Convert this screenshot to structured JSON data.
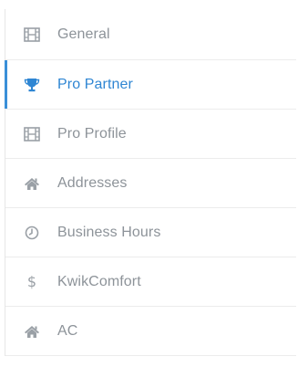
{
  "nav": {
    "items": [
      {
        "label": "General",
        "icon": "film-icon",
        "active": false
      },
      {
        "label": "Pro Partner",
        "icon": "trophy-icon",
        "active": true
      },
      {
        "label": "Pro Profile",
        "icon": "film-icon",
        "active": false
      },
      {
        "label": "Addresses",
        "icon": "home-icon",
        "active": false
      },
      {
        "label": "Business Hours",
        "icon": "clock-icon",
        "active": false
      },
      {
        "label": "KwikComfort",
        "icon": "dollar-icon",
        "active": false
      },
      {
        "label": "AC",
        "icon": "home-icon",
        "active": false
      }
    ]
  },
  "colors": {
    "accent": "#2f86d3",
    "text": "#8d9399",
    "icon": "#9aa0a6",
    "divider": "#ececec"
  }
}
